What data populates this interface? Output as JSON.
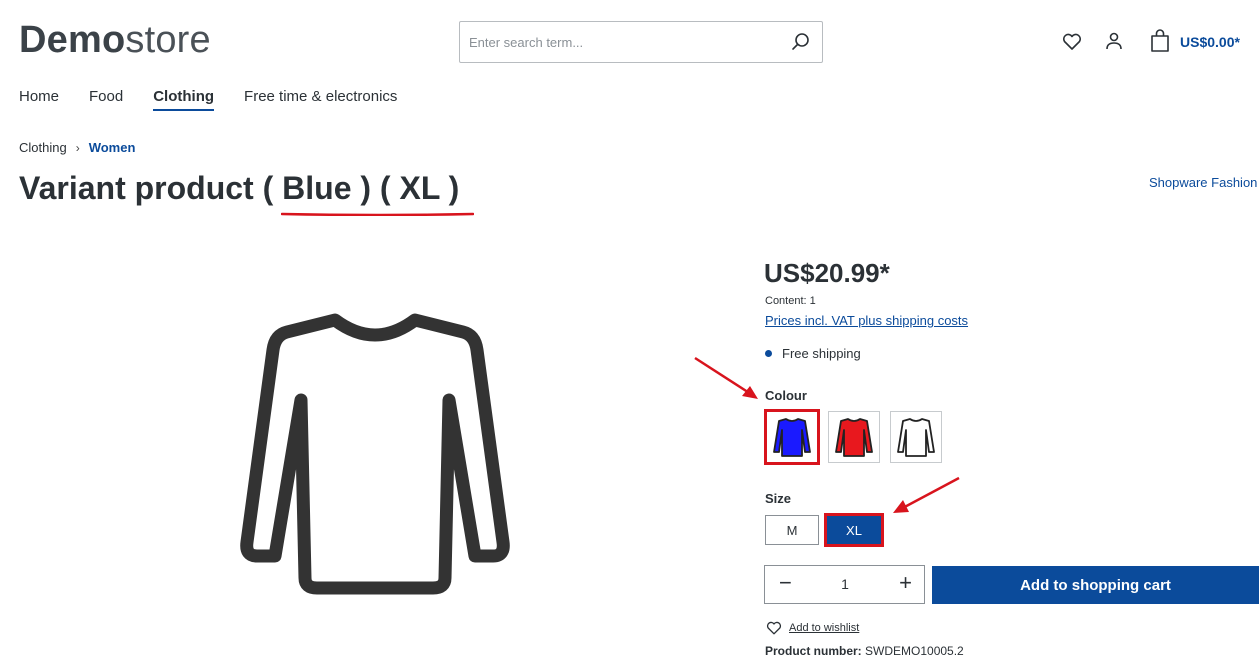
{
  "header": {
    "logo_bold": "Demo",
    "logo_light": "store",
    "search_placeholder": "Enter search term...",
    "cart_total": "US$0.00*"
  },
  "nav": {
    "items": [
      {
        "label": "Home"
      },
      {
        "label": "Food"
      },
      {
        "label": "Clothing",
        "active": true
      },
      {
        "label": "Free time & electronics"
      }
    ]
  },
  "breadcrumb": {
    "parent": "Clothing",
    "separator": "›",
    "current": "Women"
  },
  "product": {
    "title": "Variant product ( Blue ) ( XL )",
    "manufacturer": "Shopware Fashion",
    "price": "US$20.99*",
    "content": "Content: 1",
    "vat_link": "Prices incl. VAT plus shipping costs",
    "shipping": "Free shipping",
    "colour_label": "Colour",
    "colours": [
      {
        "name": "blue",
        "color": "#1a1aff",
        "selected": true
      },
      {
        "name": "red",
        "color": "#e8181e",
        "selected": false
      },
      {
        "name": "white",
        "color": "#ffffff",
        "selected": false
      }
    ],
    "size_label": "Size",
    "sizes": [
      {
        "label": "M",
        "selected": false
      },
      {
        "label": "XL",
        "selected": true
      }
    ],
    "quantity": "1",
    "quantity_minus": "−",
    "quantity_plus": "+",
    "add_to_cart": "Add to shopping cart",
    "wishlist": "Add to wishlist",
    "product_number_label": "Product number:",
    "product_number": "SWDEMO10005.2"
  },
  "colors": {
    "brand": "#0b4b9b",
    "annotation": "#d8141d"
  }
}
